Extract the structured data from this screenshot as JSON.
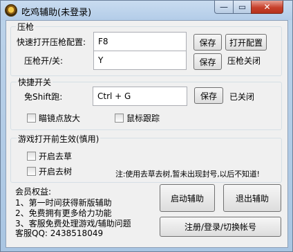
{
  "window": {
    "title": "吃鸡辅助(未登录)",
    "min_glyph": "—",
    "max_glyph": "▭",
    "close_glyph": "✕"
  },
  "recoil": {
    "legend": "压枪",
    "config_hotkey_label": "快速打开压枪配置:",
    "config_hotkey_value": "F8",
    "save1_label": "保存",
    "open_config_label": "打开配置",
    "toggle_label": "压枪开/关:",
    "toggle_value": "Y",
    "save2_label": "保存",
    "status": "压枪关闭"
  },
  "shortcut": {
    "legend": "快捷开关",
    "shift_label": "免Shift跑:",
    "shift_value": "Ctrl + G",
    "save_label": "保存",
    "status": "已关闭",
    "scope_zoom_label": "瞄镜点放大",
    "mouse_track_label": "鼠标跟踪"
  },
  "game_effect": {
    "legend": "游戏打开前生效(慎用)",
    "remove_grass_label": "开启去草",
    "remove_trees_label": "开启去树",
    "note": "注:使用去草去树,暂未出现封号,以后不知道!"
  },
  "membership": {
    "heading": "会员权益:",
    "benefit1": "1、第一时间获得新版辅助",
    "benefit2": "2、免费拥有更多给力功能",
    "benefit3": "3、客服免费处理游戏/辅助问题",
    "support": "客服QQ: 2438518049"
  },
  "actions": {
    "start_label": "启动辅助",
    "exit_label": "退出辅助",
    "account_label": "注册/登录/切换帐号"
  }
}
